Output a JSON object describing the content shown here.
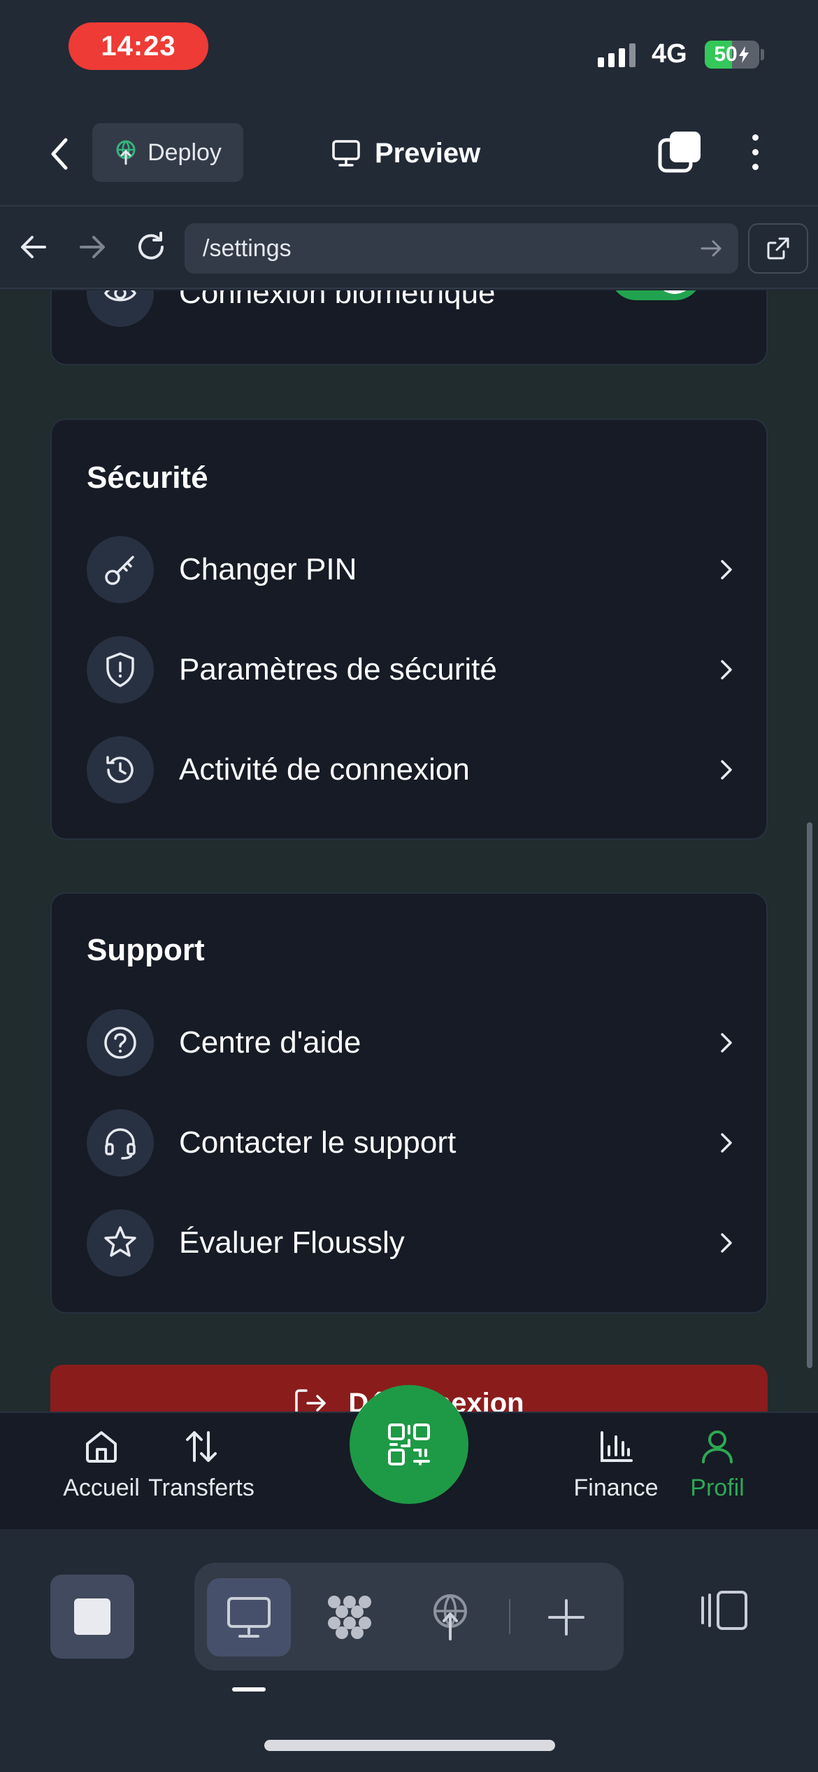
{
  "status_bar": {
    "time": "14:23",
    "network": "4G",
    "battery": "50",
    "battery_level": 0.5
  },
  "header": {
    "deploy_label": "Deploy",
    "preview_label": "Preview"
  },
  "browser": {
    "url": "/settings"
  },
  "top_card": {
    "row": {
      "label": "Connexion biométrique",
      "icon": "eye-icon",
      "toggle_on": true
    }
  },
  "security": {
    "title": "Sécurité",
    "items": [
      {
        "label": "Changer PIN",
        "icon": "key-icon"
      },
      {
        "label": "Paramètres de sécurité",
        "icon": "shield-alert-icon"
      },
      {
        "label": "Activité de connexion",
        "icon": "history-icon"
      }
    ]
  },
  "support": {
    "title": "Support",
    "items": [
      {
        "label": "Centre d'aide",
        "icon": "help-circle-icon"
      },
      {
        "label": "Contacter le support",
        "icon": "headset-icon"
      },
      {
        "label": "Évaluer Floussly",
        "icon": "star-icon"
      }
    ]
  },
  "logout": {
    "label": "Déconnexion"
  },
  "bottom_nav": {
    "items": [
      {
        "label": "Accueil",
        "icon": "home-icon"
      },
      {
        "label": "Transferts",
        "icon": "transfer-arrows-icon"
      },
      {
        "label": "Finance",
        "icon": "bar-chart-icon"
      },
      {
        "label": "Profil",
        "icon": "user-icon",
        "active": true
      }
    ],
    "fab_icon": "qr-code-icon"
  },
  "colors": {
    "accent_green": "#1e9a46",
    "active_nav": "#2ea853",
    "logout_red": "#8b1c1c",
    "time_pill": "#ee3b36"
  }
}
